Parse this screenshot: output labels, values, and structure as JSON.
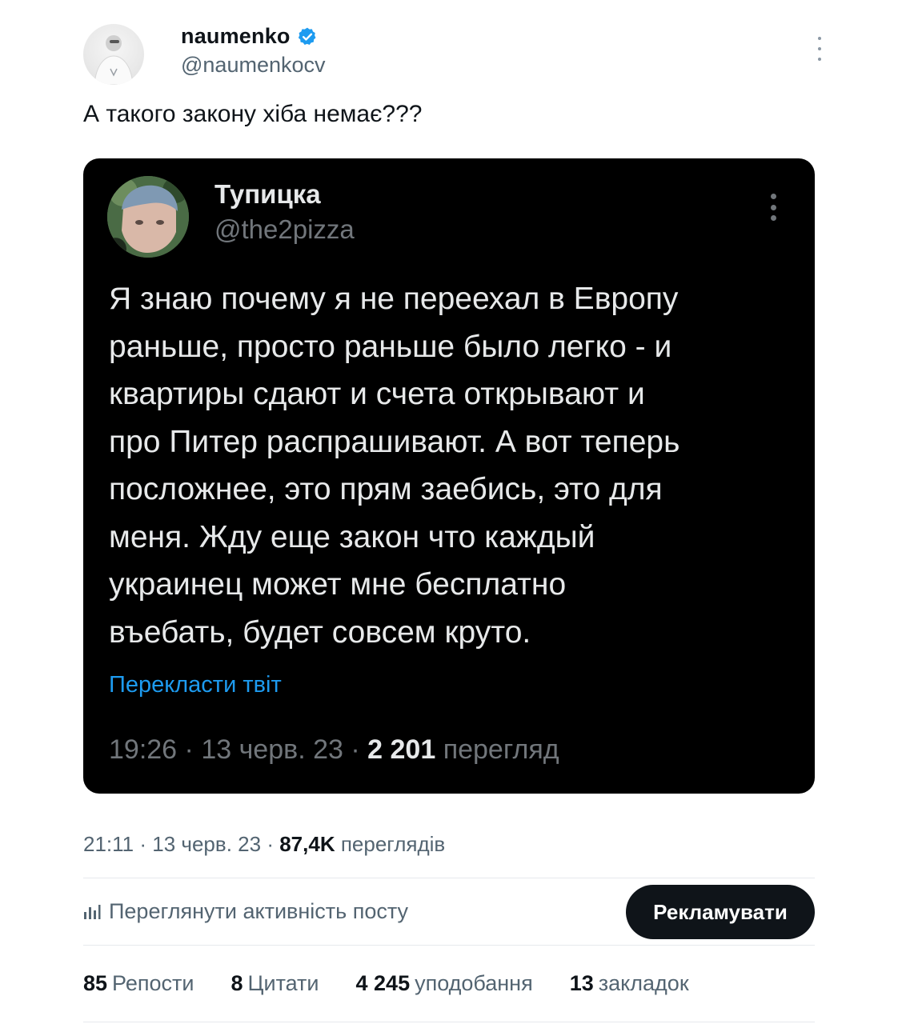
{
  "author": {
    "display_name": "naumenko",
    "handle": "@naumenkocv",
    "verified": true,
    "verified_color": "#1d9bf0"
  },
  "tweet": {
    "text": "А такого закону хіба немає???"
  },
  "quoted": {
    "display_name": "Тупицка",
    "handle": "@the2pizza",
    "body_lines": [
      "Я знаю почему я не переехал в Европу",
      "раньше, просто раньше было легко - и",
      "квартиры сдают и счета открывают и",
      "про Питер распрашивают. А вот теперь",
      "посложнее, это прям заебись, это для",
      "меня. Жду еще закон что каждый",
      "украинец может мне бесплатно",
      "въебать, будет совсем круто."
    ],
    "translate_label": "Перекласти твіт",
    "time": "19:26",
    "date": "13 черв. 23",
    "views_count": "2 201",
    "views_label": "перегляд"
  },
  "meta": {
    "time": "21:11",
    "date": "13 черв. 23",
    "views_count": "87,4K",
    "views_label": "переглядів",
    "separator": "·"
  },
  "analytics": {
    "label": "Переглянути активність посту",
    "icon": "analytics-bars-icon"
  },
  "promote": {
    "label": "Рекламувати"
  },
  "stats": [
    {
      "count": "85",
      "label": "Репости"
    },
    {
      "count": "8",
      "label": "Цитати"
    },
    {
      "count": "4 245",
      "label": "уподобання"
    },
    {
      "count": "13",
      "label": "закладок"
    }
  ],
  "colors": {
    "accent": "#1d9bf0",
    "quote_bg": "#000000",
    "muted": "#536471"
  }
}
